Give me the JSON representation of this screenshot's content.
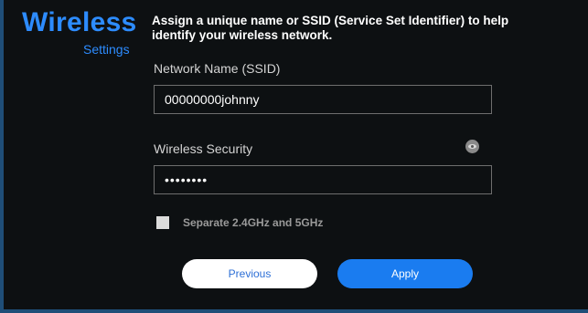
{
  "header": {
    "title": "Wireless",
    "subtitle": "Settings",
    "description": "Assign a unique name or SSID (Service Set Identifier) to help identify your wireless network."
  },
  "ssid": {
    "label": "Network Name (SSID)",
    "value": "00000000johnny"
  },
  "security": {
    "label": "Wireless Security",
    "masked_value": "••••••••",
    "toggle_icon": "eye-icon"
  },
  "separate_bands": {
    "label": "Separate 2.4GHz and 5GHz",
    "checked": false
  },
  "buttons": {
    "previous": "Previous",
    "apply": "Apply"
  },
  "colors": {
    "accent": "#2d8cff",
    "apply_button": "#1a7cf0",
    "background": "#0d1012"
  }
}
